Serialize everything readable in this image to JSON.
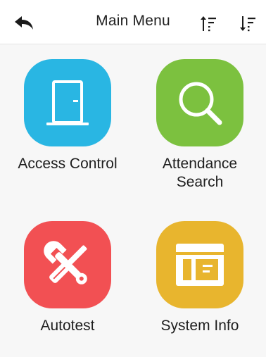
{
  "header": {
    "title": "Main Menu",
    "back_icon": "back-arrow-icon",
    "sort_ascending_icon": "sort-ascending-icon",
    "sort_descending_icon": "sort-descending-icon"
  },
  "menu": {
    "items": [
      {
        "label": "Access Control",
        "icon": "door-icon",
        "color": "#29b6e3"
      },
      {
        "label": "Attendance\nSearch",
        "icon": "magnifier-icon",
        "color": "#7cc13f"
      },
      {
        "label": "Autotest",
        "icon": "tools-icon",
        "color": "#f25053"
      },
      {
        "label": "System Info",
        "icon": "system-info-icon",
        "color": "#e8b52e"
      }
    ]
  }
}
